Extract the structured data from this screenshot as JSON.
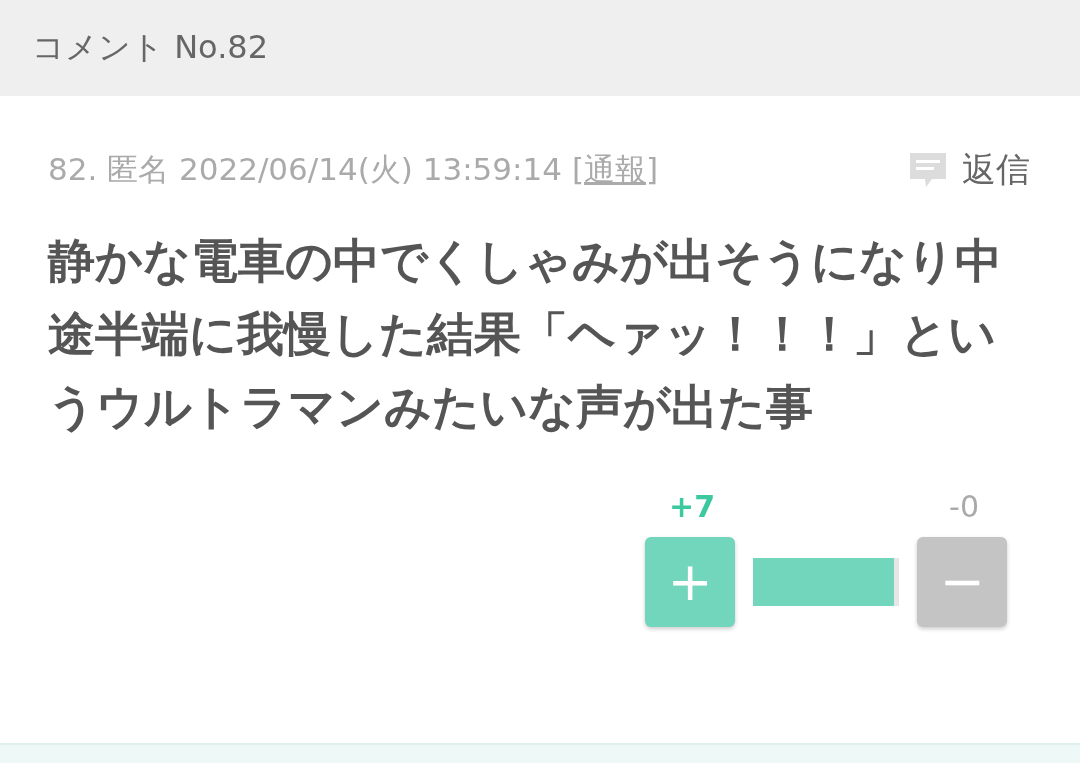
{
  "header": {
    "title": "コメント No.82"
  },
  "comment": {
    "meta": "82. 匿名 2022/06/14(火) 13:59:14",
    "report_link": "[通報]",
    "reply_label": "返信",
    "body": "静かな電車の中でくしゃみが出そうになり中途半端に我慢した結果「ヘァッ！！！」というウルトラマンみたいな声が出た事",
    "votes": {
      "plus_count": "+7",
      "minus_count": "-0",
      "plus_button": "+",
      "minus_button": "−",
      "level": 1
    }
  }
}
